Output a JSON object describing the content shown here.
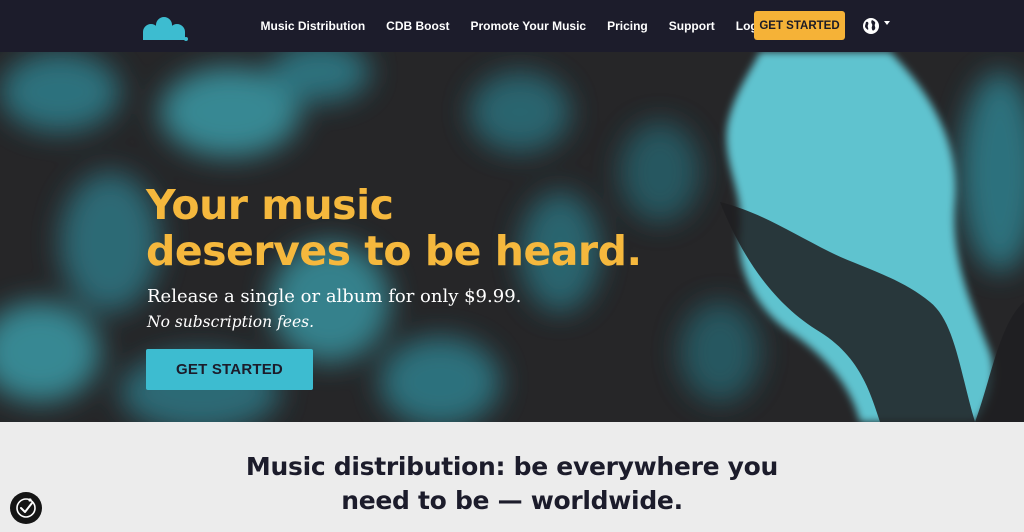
{
  "nav": {
    "logo_icon": "cdb-logo-icon",
    "links": [
      "Music Distribution",
      "CDB Boost",
      "Promote Your Music",
      "Pricing",
      "Support",
      "Log In"
    ],
    "cta_label": "GET STARTED",
    "globe_icon": "globe-icon",
    "colors": {
      "background": "#1c1c2b",
      "cta": "#f5b237"
    }
  },
  "hero": {
    "headline_line1": "Your music",
    "headline_line2": "deserves to be heard.",
    "subtitle": "Release a single or album for only $9.99.",
    "subtitle_italic": "No subscription fees.",
    "cta_label": "GET STARTED",
    "colors": {
      "headline": "#f5b83d",
      "cta": "#3dbcd0",
      "image_tint": "#3a9aa6"
    }
  },
  "section": {
    "title_line1": "Music distribution: be everywhere you",
    "title_line2": "need to be — worldwide."
  },
  "widget": {
    "icon": "accessibility-icon"
  }
}
